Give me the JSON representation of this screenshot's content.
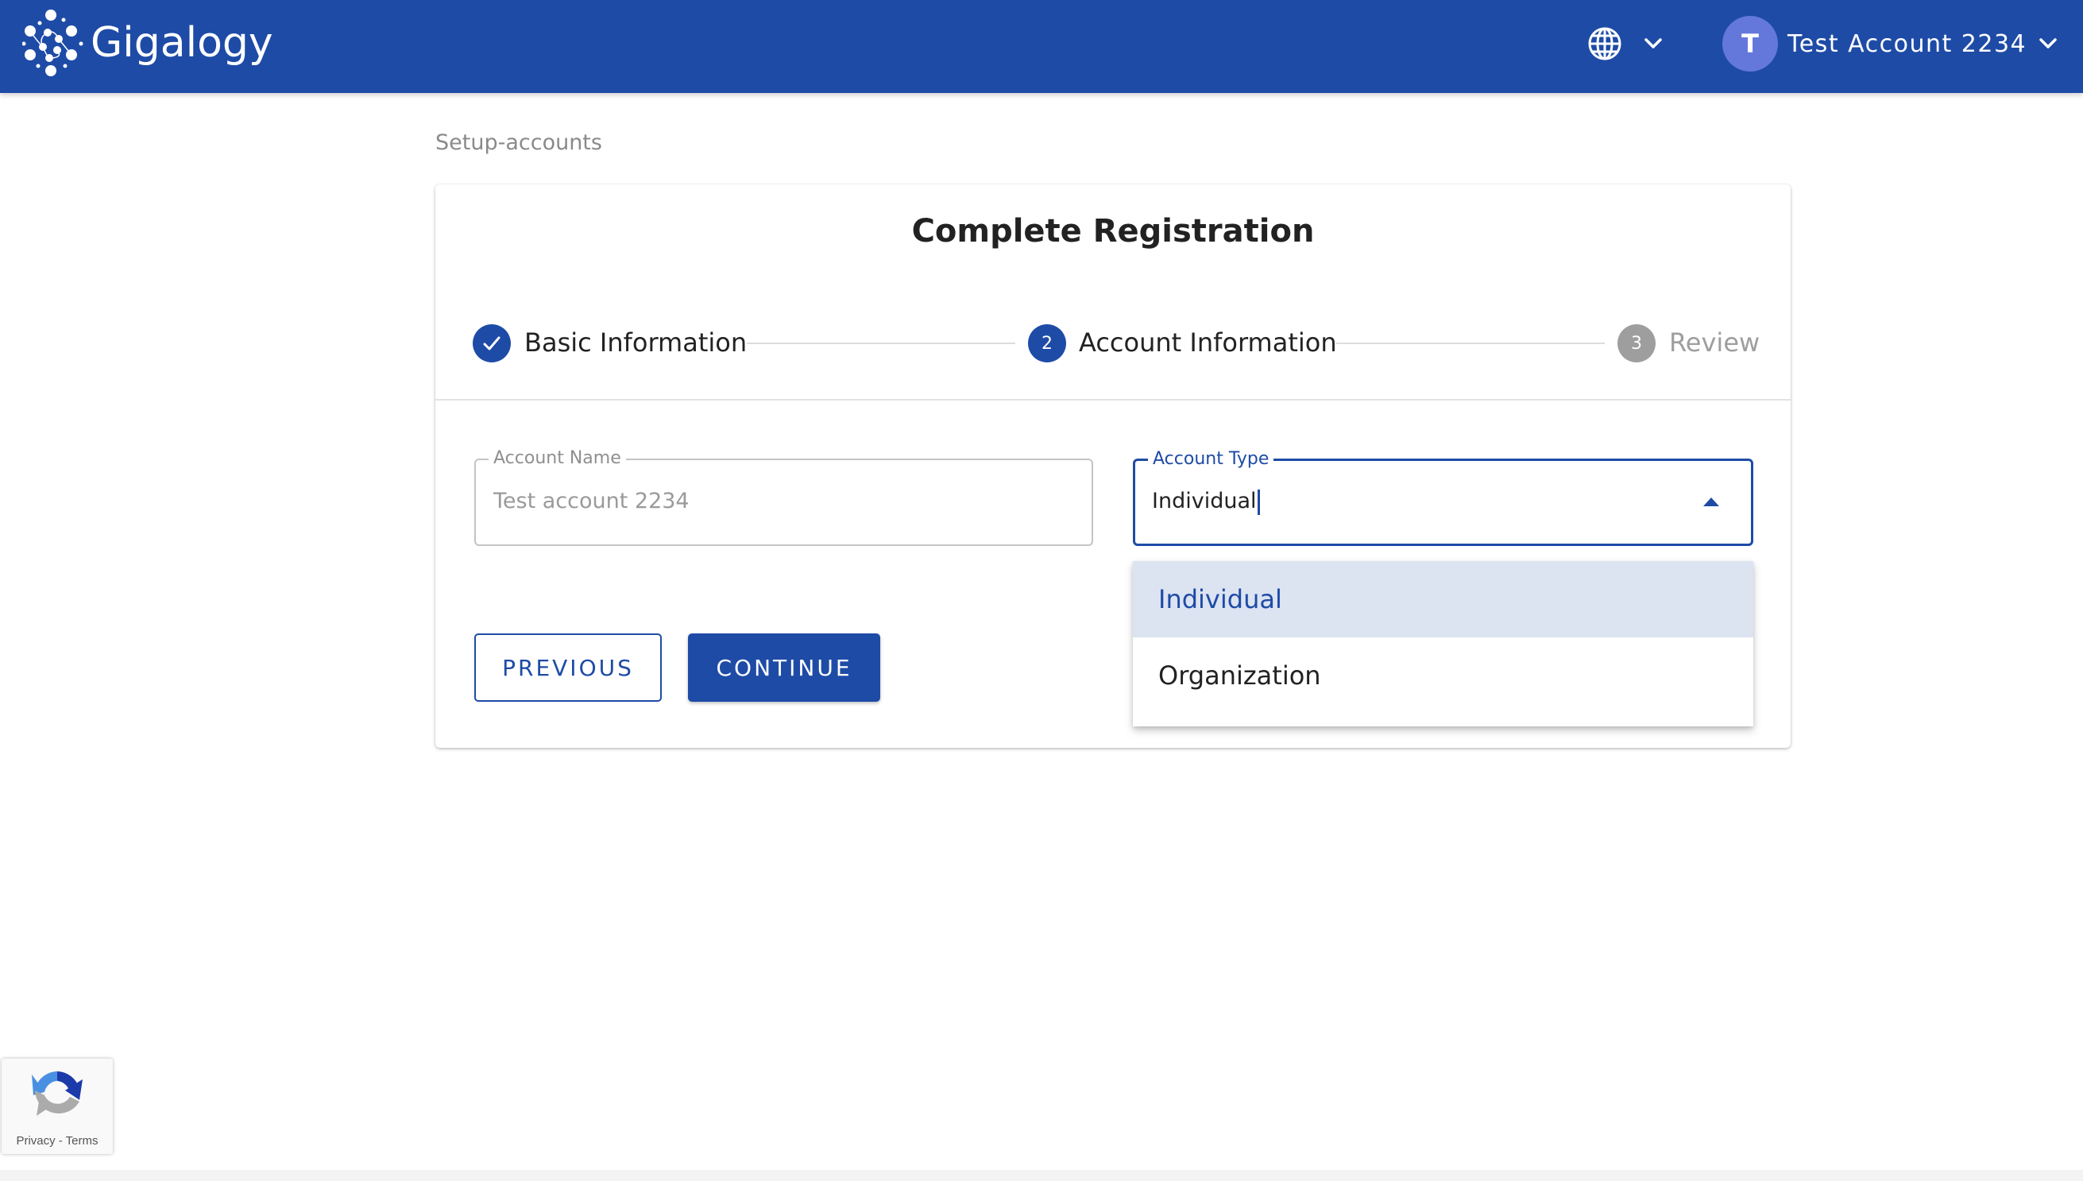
{
  "header": {
    "brand": "Gigalogy",
    "language_icon": "globe-icon",
    "user": {
      "avatar_initial": "T",
      "name": "Test Account 2234"
    }
  },
  "breadcrumb": "Setup-accounts",
  "card": {
    "title": "Complete Registration",
    "steps": [
      {
        "number": "1",
        "label": "Basic Information",
        "status": "completed"
      },
      {
        "number": "2",
        "label": "Account Information",
        "status": "active"
      },
      {
        "number": "3",
        "label": "Review",
        "status": "pending"
      }
    ],
    "fields": {
      "account_name": {
        "label": "Account Name",
        "value": "Test account 2234"
      },
      "account_type": {
        "label": "Account Type",
        "value": "Individual",
        "options": [
          "Individual",
          "Organization"
        ],
        "highlighted_option": "Individual"
      }
    },
    "buttons": {
      "previous": "PREVIOUS",
      "continue": "CONTINUE"
    }
  },
  "recaptcha": {
    "links": "Privacy - Terms"
  },
  "colors": {
    "primary": "#1E4BA6",
    "avatar": "#6478DC",
    "option_highlight": "#DCE3F1",
    "inactive": "#9E9E9E"
  }
}
